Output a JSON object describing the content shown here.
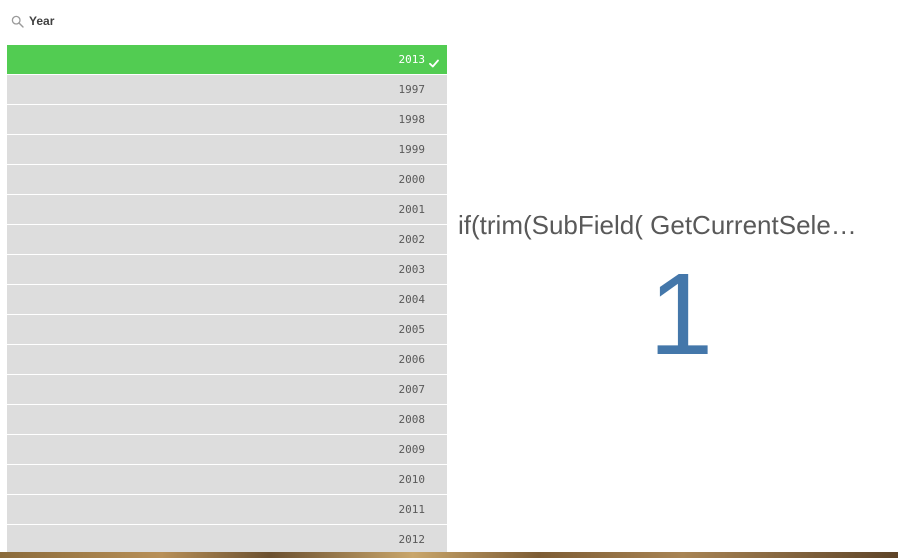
{
  "filter_pane": {
    "field_title": "Year",
    "search_icon": "search-icon",
    "check_icon": "check-icon",
    "colors": {
      "selected": "#52cc52",
      "possible": "#dddddd"
    },
    "values": [
      {
        "label": "2013",
        "state": "selected"
      },
      {
        "label": "1997",
        "state": "possible"
      },
      {
        "label": "1998",
        "state": "possible"
      },
      {
        "label": "1999",
        "state": "possible"
      },
      {
        "label": "2000",
        "state": "possible"
      },
      {
        "label": "2001",
        "state": "possible"
      },
      {
        "label": "2002",
        "state": "possible"
      },
      {
        "label": "2003",
        "state": "possible"
      },
      {
        "label": "2004",
        "state": "possible"
      },
      {
        "label": "2005",
        "state": "possible"
      },
      {
        "label": "2006",
        "state": "possible"
      },
      {
        "label": "2007",
        "state": "possible"
      },
      {
        "label": "2008",
        "state": "possible"
      },
      {
        "label": "2009",
        "state": "possible"
      },
      {
        "label": "2010",
        "state": "possible"
      },
      {
        "label": "2011",
        "state": "possible"
      },
      {
        "label": "2012",
        "state": "possible"
      }
    ]
  },
  "kpi": {
    "title": "if(trim(SubField( GetCurrentSele…",
    "value": "1",
    "value_color": "#4477aa"
  }
}
